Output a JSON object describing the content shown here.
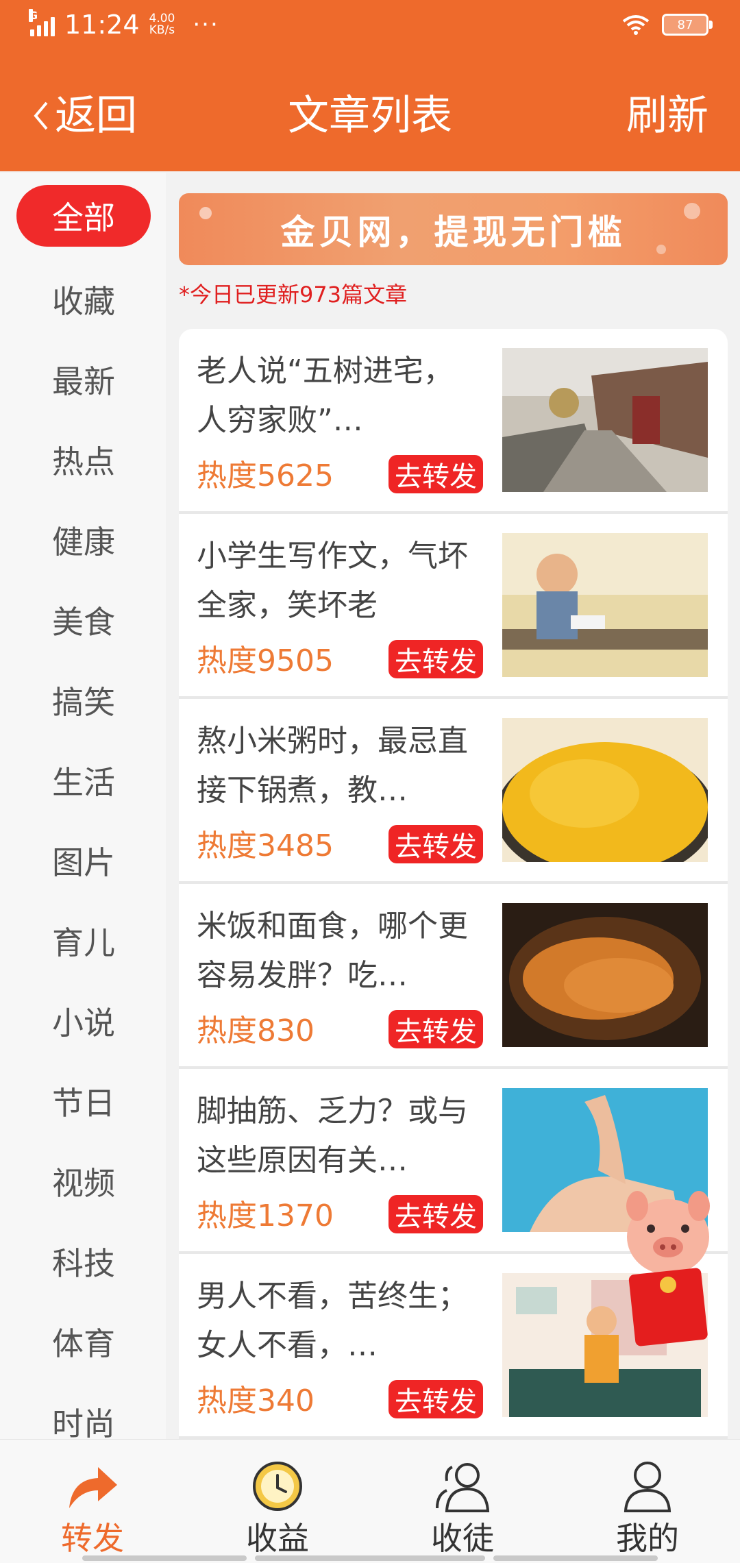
{
  "status_bar": {
    "time": "11:24",
    "network": "G",
    "speed_value": "4.00",
    "speed_unit": "KB/s",
    "more": "···",
    "battery": "87"
  },
  "header": {
    "back_label": "返回",
    "title": "文章列表",
    "refresh_label": "刷新"
  },
  "sidebar": {
    "categories": [
      "全部",
      "收藏",
      "最新",
      "热点",
      "健康",
      "美食",
      "搞笑",
      "生活",
      "图片",
      "育儿",
      "小说",
      "节日",
      "视频",
      "科技",
      "体育",
      "时尚"
    ],
    "active": "全部"
  },
  "banner": {
    "text": "金贝网，提现无门槛"
  },
  "update_notice": "*今日已更新973篇文章",
  "articles": [
    {
      "title": "老人说“五树进宅，人穷家败”…",
      "heat": "热度5625",
      "share": "去转发"
    },
    {
      "title": "小学生写作文，气坏全家，笑坏老",
      "heat": "热度9505",
      "share": "去转发"
    },
    {
      "title": "熬小米粥时，最忌直接下锅煮，教…",
      "heat": "热度3485",
      "share": "去转发"
    },
    {
      "title": "米饭和面食，哪个更容易发胖？吃…",
      "heat": "热度830",
      "share": "去转发"
    },
    {
      "title": "脚抽筋、乏力？或与这些原因有关…",
      "heat": "热度1370",
      "share": "去转发"
    },
    {
      "title": "男人不看，苦终生； 女人不看，…",
      "heat": "热度340",
      "share": "去转发"
    }
  ],
  "bottom_nav": [
    {
      "label": "转发",
      "icon": "share-arrow-icon",
      "active": true
    },
    {
      "label": "收益",
      "icon": "clock-coin-icon",
      "active": false
    },
    {
      "label": "收徒",
      "icon": "users-icon",
      "active": false
    },
    {
      "label": "我的",
      "icon": "user-icon",
      "active": false
    }
  ],
  "colors": {
    "brand": "#ee6a2c",
    "accent_red": "#ef2525",
    "heat": "#ee7a35"
  }
}
